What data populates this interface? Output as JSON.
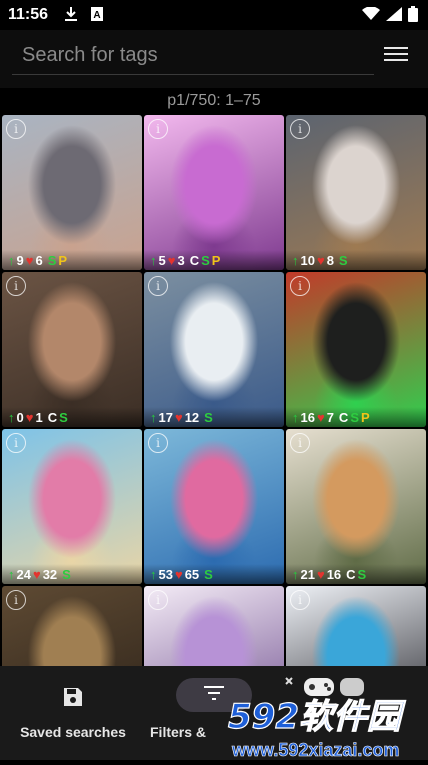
{
  "status_bar": {
    "time": "11:56",
    "icons": [
      "download-icon",
      "a-box-icon",
      "wifi-icon",
      "signal-icon",
      "battery-icon"
    ]
  },
  "search": {
    "placeholder": "Search for tags"
  },
  "page_info": "p1/750: 1–75",
  "tiles": [
    {
      "score": "9",
      "favs": "6",
      "flags": [
        "S",
        "P"
      ],
      "colors": [
        "#a9b4c2",
        "#6d6a73",
        "#c9a28e"
      ]
    },
    {
      "score": "5",
      "favs": "3",
      "flags": [
        "C",
        "S",
        "P"
      ],
      "colors": [
        "#f3b9ee",
        "#c86bd1",
        "#7e3a8f"
      ]
    },
    {
      "score": "10",
      "favs": "8",
      "flags": [
        "S"
      ],
      "colors": [
        "#5c6470",
        "#dcd4cf",
        "#9e7a52"
      ]
    },
    {
      "score": "0",
      "favs": "1",
      "flags": [
        "C",
        "S"
      ],
      "colors": [
        "#6b5444",
        "#b3876a",
        "#3b2e25"
      ]
    },
    {
      "score": "17",
      "favs": "12",
      "flags": [
        "S"
      ],
      "colors": [
        "#7c8fa0",
        "#e9eef2",
        "#3a5a8a"
      ]
    },
    {
      "score": "16",
      "favs": "7",
      "flags": [
        "C",
        "S",
        "P"
      ],
      "colors": [
        "#c23a2a",
        "#1e1f1e",
        "#2fd04f"
      ]
    },
    {
      "score": "24",
      "favs": "32",
      "flags": [
        "S"
      ],
      "colors": [
        "#7ec3e8",
        "#e27ca8",
        "#e9d5a6"
      ]
    },
    {
      "score": "53",
      "favs": "65",
      "flags": [
        "S"
      ],
      "colors": [
        "#7db8d9",
        "#e06aa0",
        "#2c6bb0"
      ]
    },
    {
      "score": "21",
      "favs": "16",
      "flags": [
        "C",
        "S"
      ],
      "colors": [
        "#e6dfd0",
        "#d49a5f",
        "#5f6b46"
      ]
    },
    {
      "score": "",
      "favs": "",
      "flags": [],
      "colors": [
        "#5e4a33",
        "#a07f52",
        "#2b2118"
      ]
    },
    {
      "score": "",
      "favs": "",
      "flags": [],
      "colors": [
        "#f4ecf6",
        "#b792d6",
        "#6b4a8c"
      ]
    },
    {
      "score": "",
      "favs": "",
      "flags": [],
      "colors": [
        "#eef1f6",
        "#3aa6d9",
        "#1c1c22"
      ]
    }
  ],
  "bottom": {
    "saved_label": "Saved searches",
    "filters_label": "Filters &"
  },
  "watermark": {
    "brand": "592软件园",
    "url": "www.592xiazai.com"
  }
}
